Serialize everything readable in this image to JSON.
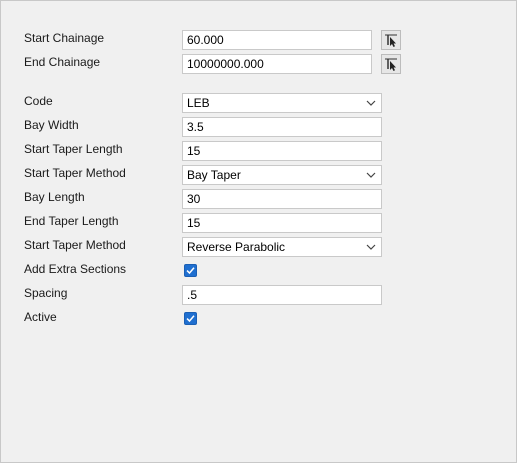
{
  "rows": {
    "start_chainage": {
      "label": "Start Chainage",
      "value": "60.000"
    },
    "end_chainage": {
      "label": "End Chainage",
      "value": "10000000.000"
    },
    "code": {
      "label": "Code",
      "value": "LEB"
    },
    "bay_width": {
      "label": "Bay Width",
      "value": "3.5"
    },
    "start_taper_length": {
      "label": "Start Taper Length",
      "value": "15"
    },
    "start_taper_method": {
      "label": "Start Taper Method",
      "value": "Bay Taper"
    },
    "bay_length": {
      "label": "Bay Length",
      "value": "30"
    },
    "end_taper_length": {
      "label": "End Taper Length",
      "value": "15"
    },
    "end_taper_method": {
      "label": "Start Taper Method",
      "value": "Reverse Parabolic"
    },
    "add_extra_sections": {
      "label": "Add Extra Sections",
      "checked": true
    },
    "spacing": {
      "label": "Spacing",
      "value": ".5"
    },
    "active": {
      "label": "Active",
      "checked": true
    }
  },
  "icons": {
    "pick_chainage": "pick-from-model-icon",
    "dropdown": "chevron-down-icon",
    "check": "checkmark-icon"
  },
  "colors": {
    "checkbox_accent": "#1f6fd0"
  }
}
